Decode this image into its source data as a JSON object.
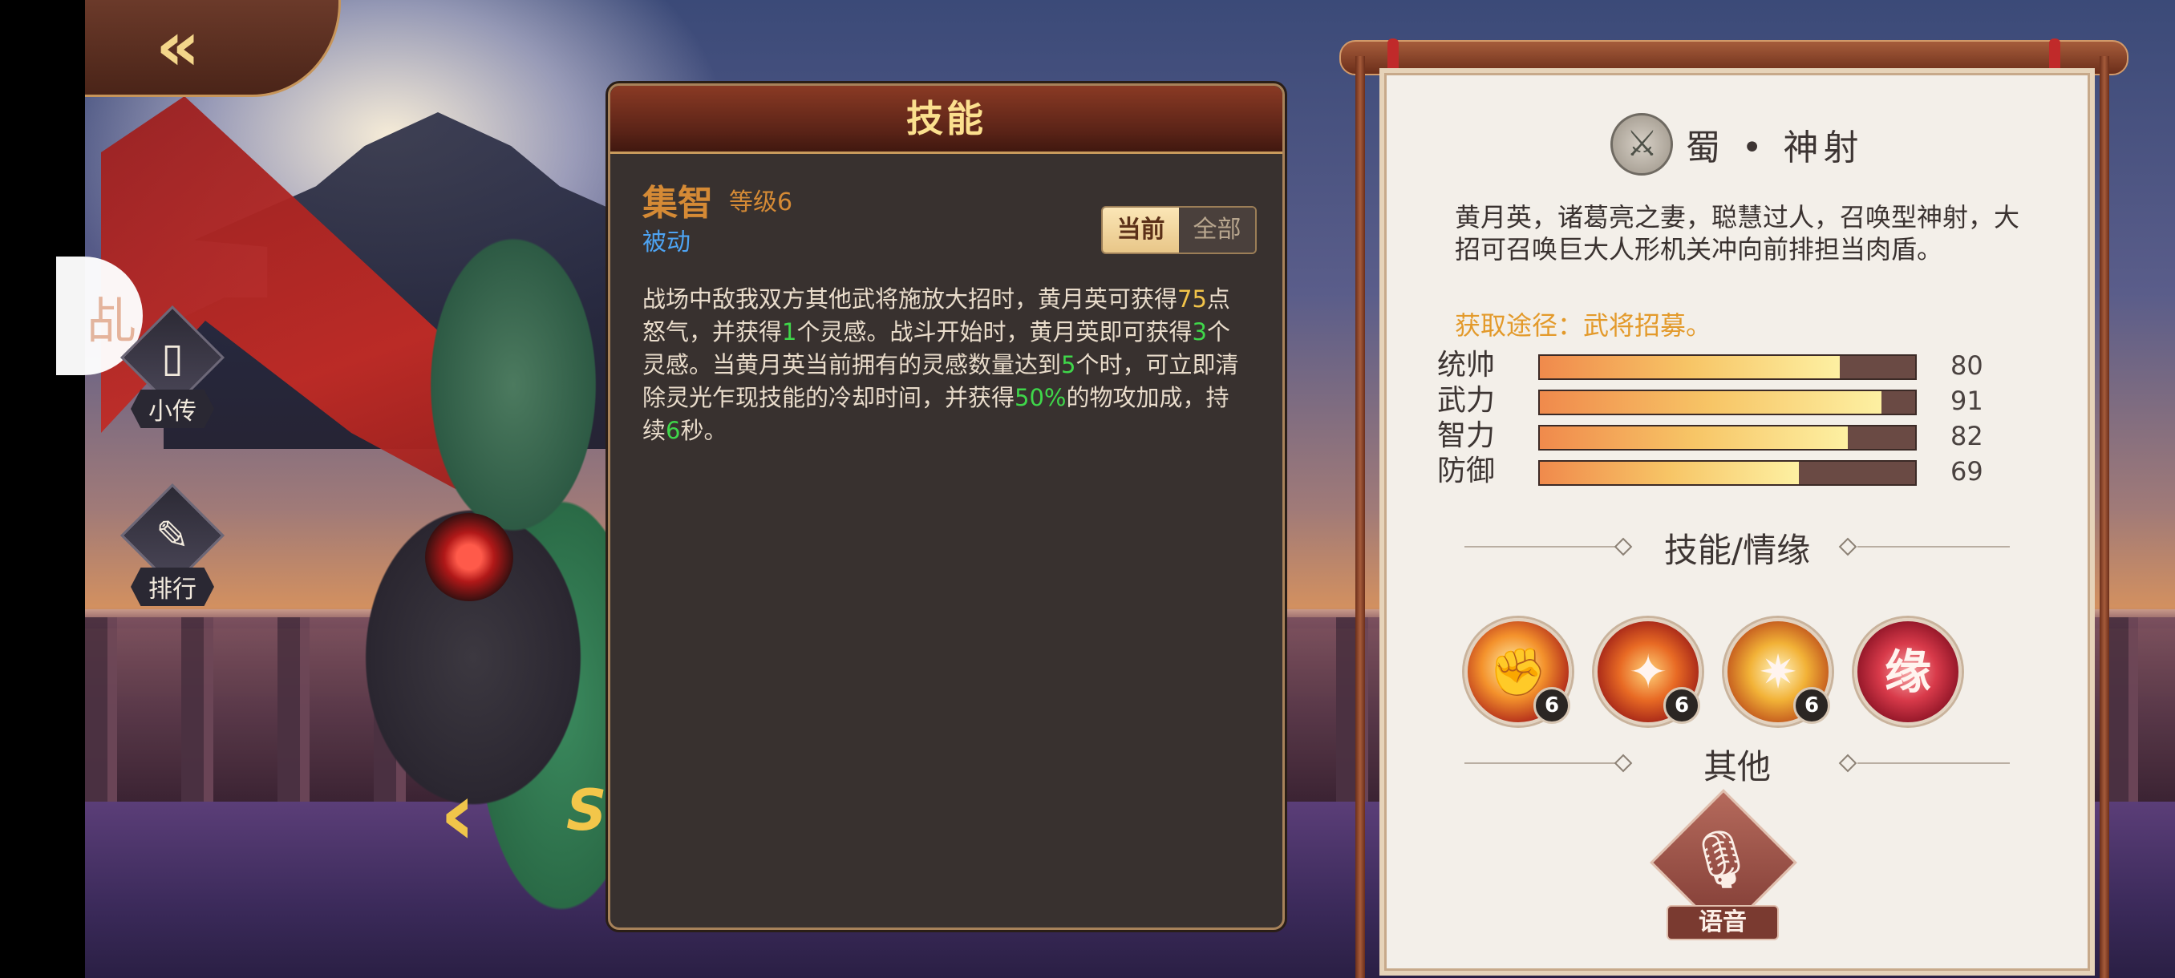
{
  "nav": {
    "back_glyph": "«",
    "side_circle_glyph": "乩",
    "bio_label": "小传",
    "rank_label": "排行",
    "left_arrow_glyph": "‹",
    "grade_text": "SS"
  },
  "skill_panel": {
    "title": "技能",
    "skill_name": "集智",
    "skill_level": "等级6",
    "skill_type": "被动",
    "toggle_current": "当前",
    "toggle_all": "全部",
    "desc_parts": [
      {
        "t": "战场中敌我双方其他武将施放大招时，黄月英可获得",
        "c": ""
      },
      {
        "t": "75",
        "c": "y"
      },
      {
        "t": "点怒气，并获得",
        "c": ""
      },
      {
        "t": "1",
        "c": "g"
      },
      {
        "t": "个灵感。战斗开始时，黄月英即可获得",
        "c": ""
      },
      {
        "t": "3",
        "c": "g"
      },
      {
        "t": "个灵感。当黄月英当前拥有的灵感数量达到",
        "c": ""
      },
      {
        "t": "5",
        "c": "g"
      },
      {
        "t": "个时，可立即清除灵光乍现技能的冷却时间，并获得",
        "c": ""
      },
      {
        "t": "50%",
        "c": "g"
      },
      {
        "t": "的物攻加成，持续",
        "c": ""
      },
      {
        "t": "6",
        "c": "g"
      },
      {
        "t": "秒。",
        "c": ""
      }
    ]
  },
  "info_card": {
    "faction_glyph": "⚔",
    "faction_text": "蜀 • 神射",
    "bio": "黄月英，诸葛亮之妻，聪慧过人，召唤型神射，大招可召唤巨大人形机关冲向前排担当肉盾。",
    "source": "获取途径：武将招募。",
    "stats": [
      {
        "label": "统帅",
        "value": "80"
      },
      {
        "label": "武力",
        "value": "91"
      },
      {
        "label": "智力",
        "value": "82"
      },
      {
        "label": "防御",
        "value": "69"
      }
    ],
    "skills_title": "技能/情缘",
    "skills": [
      {
        "glyph": "✊",
        "level": "6"
      },
      {
        "glyph": "✦",
        "level": "6"
      },
      {
        "glyph": "✷",
        "level": "6"
      },
      {
        "glyph": "缘",
        "level": ""
      }
    ],
    "other_title": "其他",
    "voice_label": "语音",
    "voice_glyph": "🎙"
  },
  "colors": {
    "accent_gold": "#fbe08e",
    "skill_name": "#d58a35",
    "passive_blue": "#4da3f2",
    "highlight_green": "#3fd74a",
    "highlight_yellow": "#f2c44a",
    "source_orange": "#e39a2b"
  }
}
